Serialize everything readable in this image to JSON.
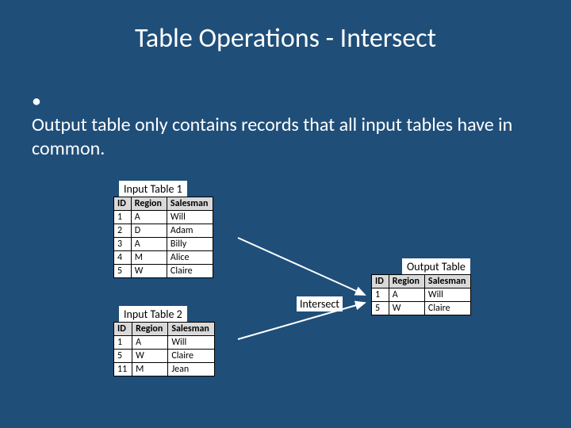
{
  "title": "Table Operations - Intersect",
  "bullet": "Output table only contains records that all input tables have in common.",
  "labels": {
    "input1": "Input Table 1",
    "input2": "Input Table 2",
    "output": "Output Table",
    "op": "Intersect"
  },
  "cols": {
    "c0": "ID",
    "c1": "Region",
    "c2": "Salesman"
  },
  "t1": {
    "r0": {
      "c0": "1",
      "c1": "A",
      "c2": "Will"
    },
    "r1": {
      "c0": "2",
      "c1": "D",
      "c2": "Adam"
    },
    "r2": {
      "c0": "3",
      "c1": "A",
      "c2": "Billy"
    },
    "r3": {
      "c0": "4",
      "c1": "M",
      "c2": "Alice"
    },
    "r4": {
      "c0": "5",
      "c1": "W",
      "c2": "Claire"
    }
  },
  "t2": {
    "r0": {
      "c0": "1",
      "c1": "A",
      "c2": "Will"
    },
    "r1": {
      "c0": "5",
      "c1": "W",
      "c2": "Claire"
    },
    "r2": {
      "c0": "11",
      "c1": "M",
      "c2": "Jean"
    }
  },
  "t3": {
    "r0": {
      "c0": "1",
      "c1": "A",
      "c2": "Will"
    },
    "r1": {
      "c0": "5",
      "c1": "W",
      "c2": "Claire"
    }
  }
}
